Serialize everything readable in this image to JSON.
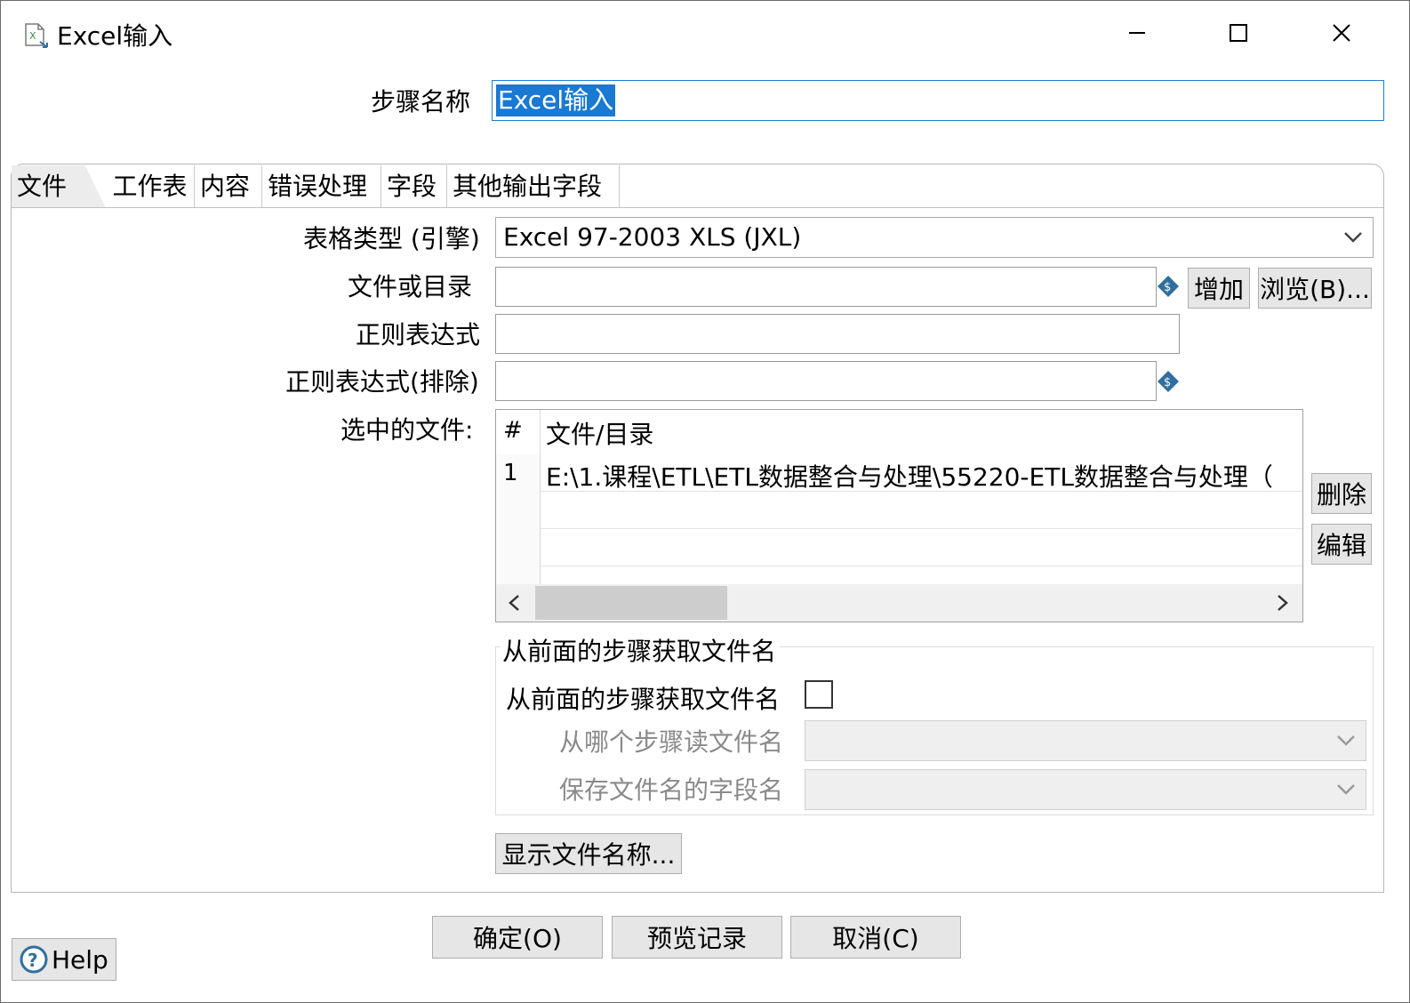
{
  "window": {
    "title": "Excel输入",
    "controls": [
      "minimize",
      "maximize",
      "close"
    ]
  },
  "step_name": {
    "label": "步骤名称",
    "value": "Excel输入"
  },
  "tabs": [
    {
      "label": "文件",
      "active": true
    },
    {
      "label": "工作表"
    },
    {
      "label": "内容"
    },
    {
      "label": "错误处理"
    },
    {
      "label": "字段"
    },
    {
      "label": "其他输出字段"
    }
  ],
  "file_tab": {
    "spreadsheet_type_label": "表格类型 (引擎)",
    "spreadsheet_type_value": "Excel 97-2003 XLS (JXL)",
    "file_or_dir_label": "文件或目录",
    "file_or_dir_value": "",
    "add_button": "增加",
    "browse_button": "浏览(B)...",
    "regex_label": "正则表达式",
    "regex_value": "",
    "regex_exclude_label": "正则表达式(排除)",
    "regex_exclude_value": "",
    "selected_files_label": "选中的文件:",
    "table": {
      "col_num": "#",
      "col_file": "文件/目录",
      "rows": [
        {
          "num": "1",
          "file": "E:\\1.课程\\ETL\\ETL数据整合与处理\\55220-ETL数据整合与处理（"
        }
      ]
    },
    "delete_button": "删除",
    "edit_button": "编辑",
    "group_title": "从前面的步骤获取文件名",
    "accept_filenames_label": "从前面的步骤获取文件名",
    "accept_filenames_checked": false,
    "step_to_read_label": "从哪个步骤读文件名",
    "step_to_read_value": "",
    "field_name_label": "保存文件名的字段名",
    "field_name_value": "",
    "show_filenames_button": "显示文件名称..."
  },
  "footer": {
    "ok_button": "确定(O)",
    "preview_button": "预览记录",
    "cancel_button": "取消(C)",
    "help_button": "Help"
  },
  "colors": {
    "accent": "#1979d3",
    "button_bg": "#e6e6e6",
    "var_icon": "#2f6f9f"
  }
}
